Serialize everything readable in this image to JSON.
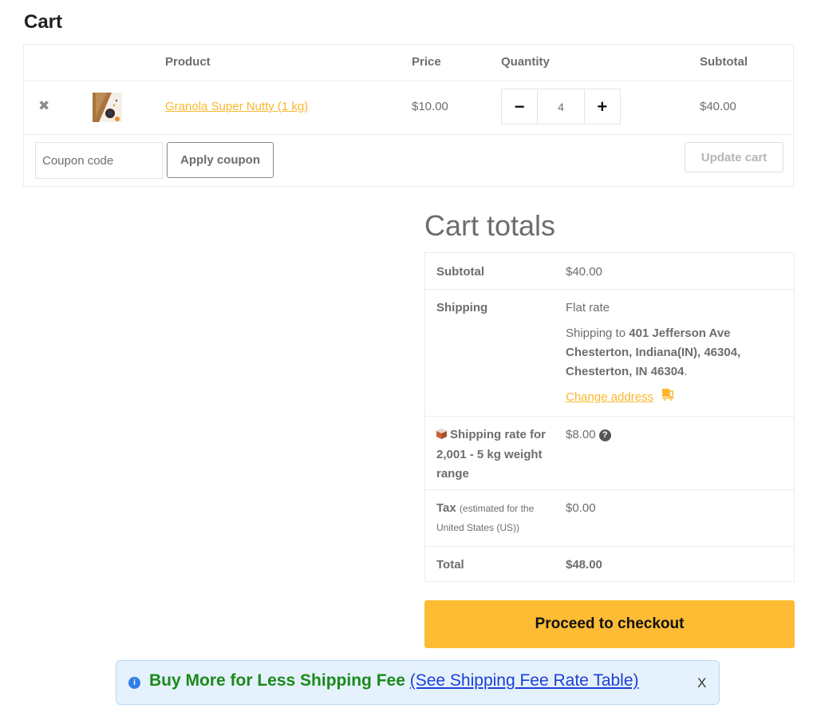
{
  "page": {
    "title": "Cart"
  },
  "cart_table": {
    "headers": {
      "product": "Product",
      "price": "Price",
      "quantity": "Quantity",
      "subtotal": "Subtotal"
    },
    "items": [
      {
        "remove_icon": "✖",
        "name": "Granola Super Nutty (1 kg)",
        "price": "$10.00",
        "quantity": "4",
        "subtotal": "$40.00"
      }
    ],
    "qty_minus": "−",
    "qty_plus": "+",
    "coupon_placeholder": "Coupon code",
    "apply_coupon_label": "Apply coupon",
    "update_cart_label": "Update cart"
  },
  "totals": {
    "title": "Cart totals",
    "subtotal_label": "Subtotal",
    "subtotal_value": "$40.00",
    "shipping_label": "Shipping",
    "shipping_method": "Flat rate",
    "shipping_to_prefix": "Shipping to ",
    "shipping_address": "401 Jefferson Ave Chesterton, Indiana(IN), 46304, Chesterton, IN 46304",
    "shipping_to_suffix": ".",
    "change_address_label": "Change address",
    "rate_label": "Shipping rate for 2,001 - 5 kg weight range",
    "rate_value": "$8.00",
    "tax_label": "Tax",
    "tax_note": "(estimated for the United States (US))",
    "tax_value": "$0.00",
    "total_label": "Total",
    "total_value": "$48.00"
  },
  "checkout_label": "Proceed to checkout",
  "notice": {
    "info_icon": "i",
    "text": "Buy More for Less Shipping Fee ",
    "link_text": "(See Shipping Fee Rate Table)",
    "close": "X"
  },
  "colors": {
    "accent": "#fbb72d",
    "checkout_bg": "#fdbc34",
    "notice_bg": "#e5f1fd",
    "notice_text": "#1a8a1a",
    "notice_link": "#1c3fd6"
  }
}
